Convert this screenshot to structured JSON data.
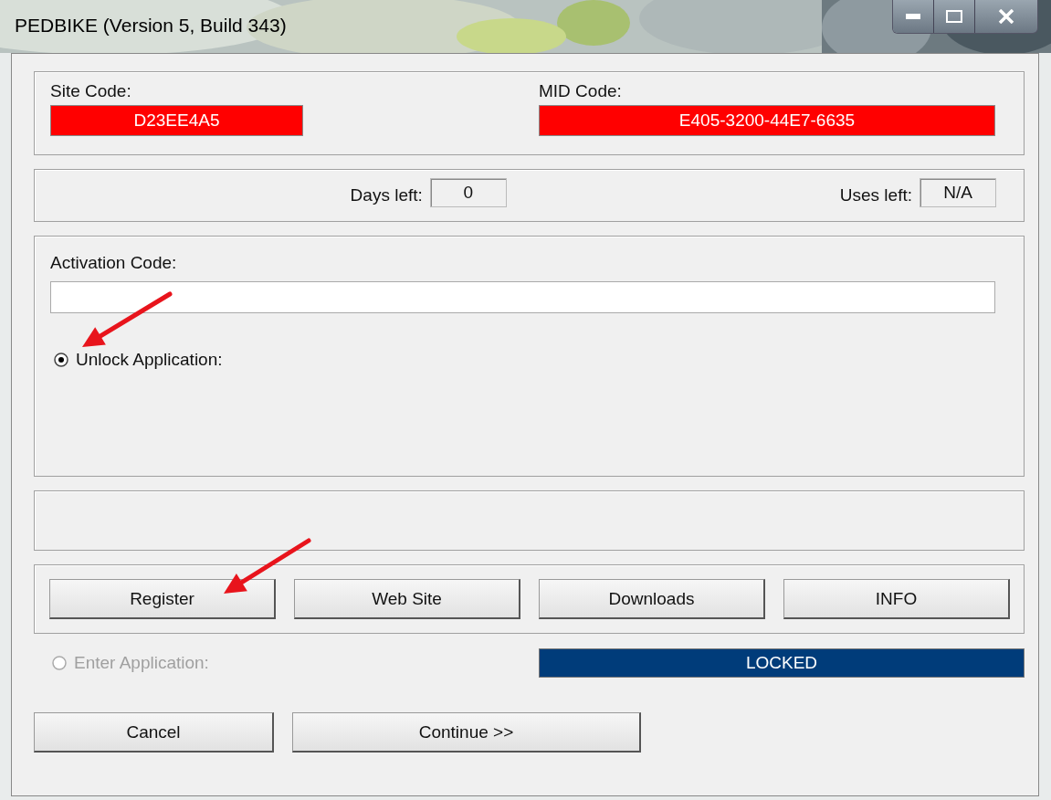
{
  "window": {
    "title": "PEDBIKE (Version 5, Build 343)"
  },
  "codes": [
    {
      "label": "Site Code:",
      "value": "D23EE4A5",
      "invalid": true
    },
    {
      "label": "MID Code:",
      "value": "E405-3200-44E7-6635",
      "invalid": true
    }
  ],
  "counters": [
    {
      "label": "Days left:",
      "value": "0"
    },
    {
      "label": "Uses left:",
      "value": "N/A"
    }
  ],
  "activation": {
    "label": "Activation Code:"
  },
  "unlock_option": {
    "label": "Unlock Application:",
    "selected": true,
    "disabled": false
  },
  "actions": [
    "Register",
    "Web Site",
    "Downloads",
    "INFO"
  ],
  "enter_option": {
    "label": "Enter Application:",
    "selected": false,
    "disabled": true
  },
  "status": "LOCKED",
  "footer_buttons": [
    "Cancel",
    "Continue >>"
  ]
}
